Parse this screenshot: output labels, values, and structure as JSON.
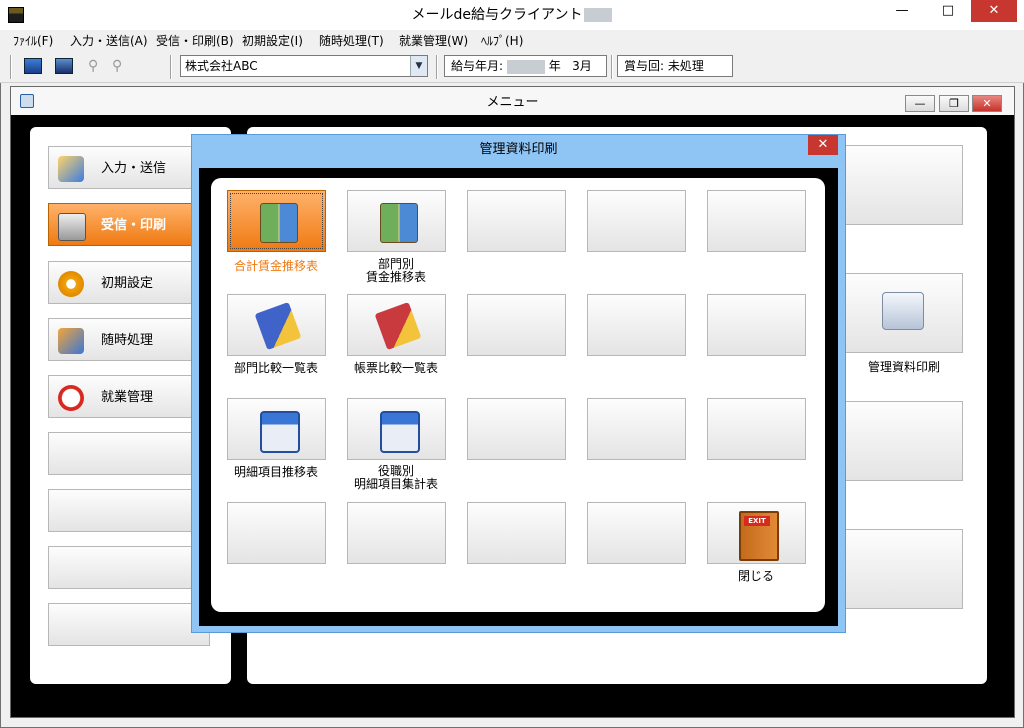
{
  "window": {
    "title": "メールde給与クライアント"
  },
  "menubar": [
    "ﾌｧｲﾙ(F)",
    "入力・送信(A)",
    "受信・印刷(B)",
    "初期設定(I)",
    "随時処理(T)",
    "就業管理(W)",
    "ﾍﾙﾌﾟ(H)"
  ],
  "toolbar": {
    "company": "株式会社ABC",
    "pay_label": "給与年月:",
    "year_suffix": "年",
    "month": "3月",
    "bonus": "賞与回: 未処理"
  },
  "menu_window": {
    "title": "メニュー",
    "side_items": [
      "入力・送信",
      "受信・印刷",
      "初期設定",
      "随時処理",
      "就業管理"
    ],
    "right_label": "管理資料印刷"
  },
  "dialog": {
    "title": "管理資料印刷",
    "items": {
      "r1c1": "合計賃金推移表",
      "r1c2a": "部門別",
      "r1c2b": "賃金推移表",
      "r2c1": "部門比較一覧表",
      "r2c2": "帳票比較一覧表",
      "r3c1": "明細項目推移表",
      "r3c2a": "役職別",
      "r3c2b": "明細項目集計表",
      "exit_sign": "EXIT",
      "close": "閉じる"
    }
  },
  "colors": {
    "active": "#ef7a12",
    "dialog": "#8ec5f5"
  }
}
